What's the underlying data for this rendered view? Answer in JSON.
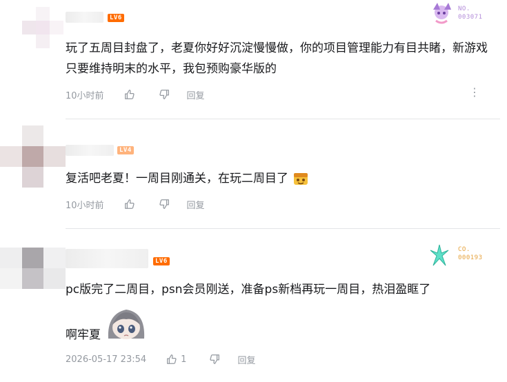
{
  "comments": [
    {
      "level": "LV6",
      "text": "玩了五周目封盘了，老夏你好好沉淀慢慢做，你的项目管理能力有目共睹，新游戏只要维持明末的水平，我包预购豪华版的",
      "time": "10小时前",
      "reply": "回复",
      "badge_top": "NO.",
      "badge_num": "003071"
    },
    {
      "level": "LV4",
      "text": "复活吧老夏！一周目刚通关，在玩二周目了",
      "time": "10小时前",
      "reply": "回复"
    },
    {
      "level": "LV6",
      "text": "pc版完了二周目，psn会员刚送，准备ps新档再玩一周目，热泪盈眶了",
      "text2": "啊牢夏",
      "time": "2026-05-17 23:54",
      "likes": "1",
      "reply": "回复",
      "badge_top": "CO.",
      "badge_num": "000193"
    }
  ],
  "colors": {
    "level6": "#ff6c00",
    "level4": "#ffb37c",
    "meta": "#9499a0",
    "divider": "#e3e5e7",
    "badge1": "#b38cd9",
    "badge2": "#e6a23c"
  },
  "icons": [
    "thumb-up-icon",
    "thumb-down-icon",
    "more-icon",
    "fan-badge-icon",
    "emoji-icon",
    "sticker-image"
  ]
}
